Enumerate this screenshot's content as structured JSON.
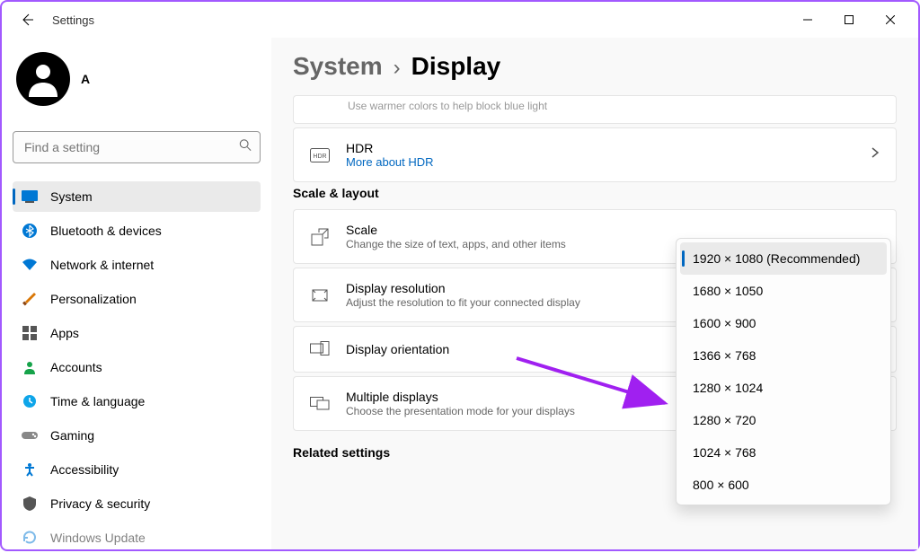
{
  "titlebar": {
    "title": "Settings"
  },
  "profile": {
    "name": "A",
    "email": ""
  },
  "search": {
    "placeholder": "Find a setting"
  },
  "nav": {
    "items": [
      {
        "label": "System",
        "icon": "system"
      },
      {
        "label": "Bluetooth & devices",
        "icon": "bluetooth"
      },
      {
        "label": "Network & internet",
        "icon": "network"
      },
      {
        "label": "Personalization",
        "icon": "personalization"
      },
      {
        "label": "Apps",
        "icon": "apps"
      },
      {
        "label": "Accounts",
        "icon": "accounts"
      },
      {
        "label": "Time & language",
        "icon": "time"
      },
      {
        "label": "Gaming",
        "icon": "gaming"
      },
      {
        "label": "Accessibility",
        "icon": "accessibility"
      },
      {
        "label": "Privacy & security",
        "icon": "privacy"
      },
      {
        "label": "Windows Update",
        "icon": "update"
      }
    ],
    "activeIndex": 0
  },
  "breadcrumb": {
    "parent": "System",
    "current": "Display"
  },
  "truncatedHint": "Use warmer colors to help block blue light",
  "hdr": {
    "label": "HDR",
    "link": "More about HDR"
  },
  "sections": {
    "scaleLayout": {
      "title": "Scale & layout",
      "scale": {
        "label": "Scale",
        "desc": "Change the size of text, apps, and other items"
      },
      "resolution": {
        "label": "Display resolution",
        "desc": "Adjust the resolution to fit your connected display"
      },
      "orientation": {
        "label": "Display orientation"
      },
      "multiple": {
        "label": "Multiple displays",
        "desc": "Choose the presentation mode for your displays"
      }
    },
    "related": {
      "title": "Related settings"
    }
  },
  "resolutionDropdown": {
    "options": [
      "1920 × 1080 (Recommended)",
      "1680 × 1050",
      "1600 × 900",
      "1366 × 768",
      "1280 × 1024",
      "1280 × 720",
      "1024 × 768",
      "800 × 600"
    ],
    "selectedIndex": 0,
    "highlightedIndex": 4
  }
}
